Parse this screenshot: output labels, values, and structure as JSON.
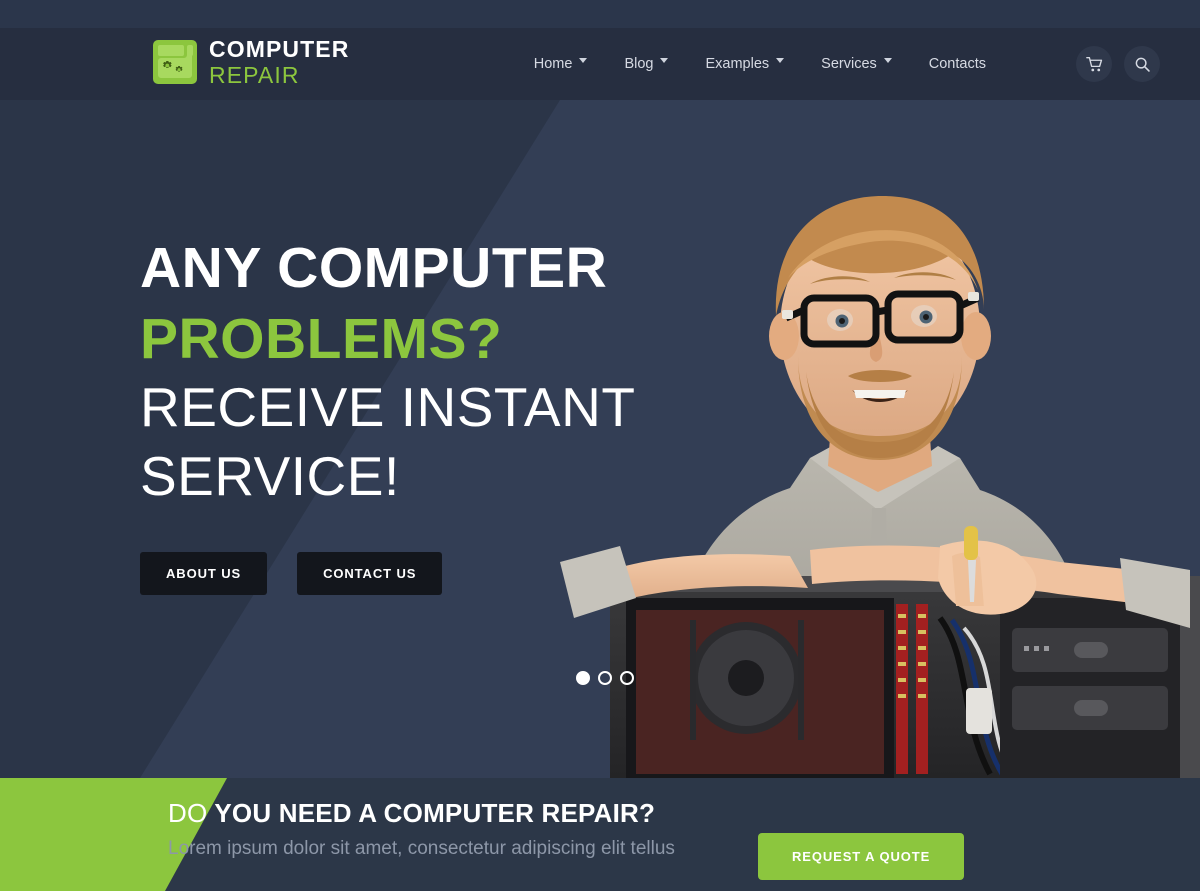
{
  "brand": {
    "logo_icon": "computer-gears-icon",
    "name_top": "COMPUTER",
    "name_bottom": "REPAIR",
    "accent_color": "#8cc63e",
    "name_top_color": "#ffffff"
  },
  "header": {
    "background_color": "#262e40",
    "nav": [
      {
        "label": "Home",
        "has_dropdown": true
      },
      {
        "label": "Blog",
        "has_dropdown": true
      },
      {
        "label": "Examples",
        "has_dropdown": true
      },
      {
        "label": "Services",
        "has_dropdown": true
      },
      {
        "label": "Contacts",
        "has_dropdown": false
      }
    ],
    "cart_icon": "shopping-cart-icon",
    "search_icon": "search-icon"
  },
  "hero": {
    "background_color": "#2f3a50",
    "heading_line1": "ANY COMPUTER",
    "heading_line2": "PROBLEMS?",
    "heading_line3": "RECEIVE INSTANT",
    "heading_line4": "SERVICE!",
    "heading_line2_color": "#8cc63e",
    "buttons": [
      {
        "label": "ABOUT US"
      },
      {
        "label": "CONTACT US"
      }
    ],
    "slider": {
      "total": 3,
      "active_index": 0
    },
    "image_alt": "smiling-bearded-technician-with-glasses-leaning-on-open-computer-case"
  },
  "bottom": {
    "background_color": "#2c3748",
    "accent_shape_color": "#8cc63e",
    "title_thin": "DO",
    "title_bold": "YOU NEED A COMPUTER REPAIR?",
    "subtitle": "Lorem ipsum dolor sit amet, consectetur adipiscing elit tellus",
    "cta_label": "REQUEST A QUOTE",
    "cta_color": "#8cc63e"
  }
}
